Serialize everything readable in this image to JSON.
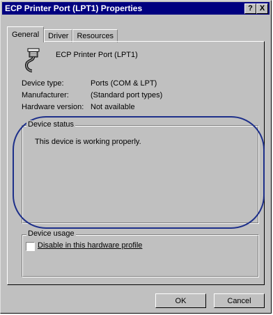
{
  "window": {
    "title": "ECP Printer Port (LPT1) Properties",
    "help_label": "?",
    "close_label": "X"
  },
  "tabs": [
    {
      "label": "General",
      "active": true
    },
    {
      "label": "Driver",
      "active": false
    },
    {
      "label": "Resources",
      "active": false
    }
  ],
  "device": {
    "icon": "printer-port-icon",
    "name": "ECP Printer Port (LPT1)"
  },
  "properties": [
    {
      "label": "Device type:",
      "value": "Ports (COM & LPT)"
    },
    {
      "label": "Manufacturer:",
      "value": "(Standard port types)"
    },
    {
      "label": "Hardware version:",
      "value": "Not available"
    }
  ],
  "status": {
    "legend": "Device status",
    "text": "This device is working properly."
  },
  "usage": {
    "legend": "Device usage",
    "checkbox_label": "Disable in this hardware profile",
    "checked": false
  },
  "buttons": {
    "ok": "OK",
    "cancel": "Cancel"
  },
  "annotation": {
    "color": "#1d2f8a"
  }
}
